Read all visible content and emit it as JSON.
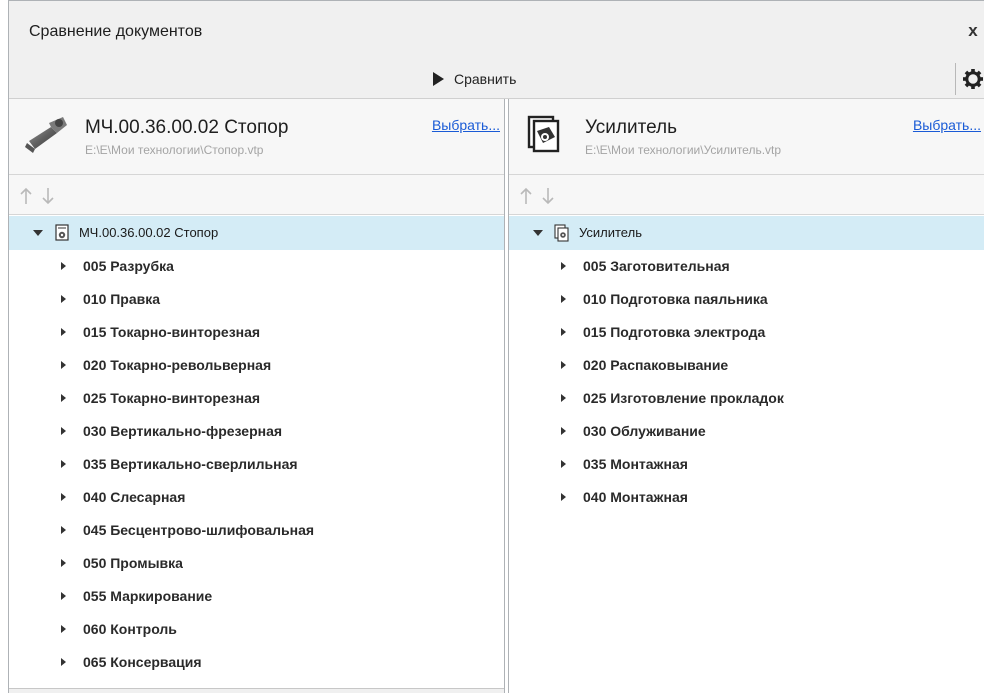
{
  "window": {
    "title": "Сравнение документов",
    "close_label": "x"
  },
  "toolbar": {
    "compare_label": "Сравнить"
  },
  "left": {
    "doc_name": "МЧ.00.36.00.02 Стопор",
    "doc_path": "E:\\E\\Мои технологии\\Стопор.vtp",
    "choose_label": "Выбрать...",
    "tree_root": "МЧ.00.36.00.02 Стопор",
    "items": [
      "005 Разрубка",
      "010 Правка",
      "015 Токарно-винторезная",
      "020 Токарно-револьверная",
      "025 Токарно-винторезная",
      "030 Вертикально-фрезерная",
      "035 Вертикально-сверлильная",
      "040 Слесарная",
      "045 Бесцентрово-шлифовальная",
      "050 Промывка",
      "055 Маркирование",
      "060 Контроль",
      "065 Консервация"
    ]
  },
  "right": {
    "doc_name": "Усилитель",
    "doc_path": "E:\\E\\Мои технологии\\Усилитель.vtp",
    "choose_label": "Выбрать...",
    "tree_root": "Усилитель",
    "items": [
      "005 Заготовительная",
      "010 Подготовка паяльника",
      "015 Подготовка  электрода",
      "020 Распаковывание",
      "025 Изготовление прокладок",
      "030 Облуживание",
      "035 Монтажная",
      "040 Монтажная"
    ]
  },
  "icons": {
    "close": "close-icon",
    "compare": "play-icon",
    "settings": "gear-icon",
    "left_doc": "part-3d-icon",
    "right_doc": "assembly-document-icon",
    "move_up": "arrow-up-icon",
    "move_down": "arrow-down-icon",
    "expanded": "chevron-down-icon",
    "collapsed": "chevron-right-icon"
  },
  "colors": {
    "selected_row": "#d4ecf6",
    "link": "#1a5bd6",
    "path_text": "#a4a4a4"
  }
}
